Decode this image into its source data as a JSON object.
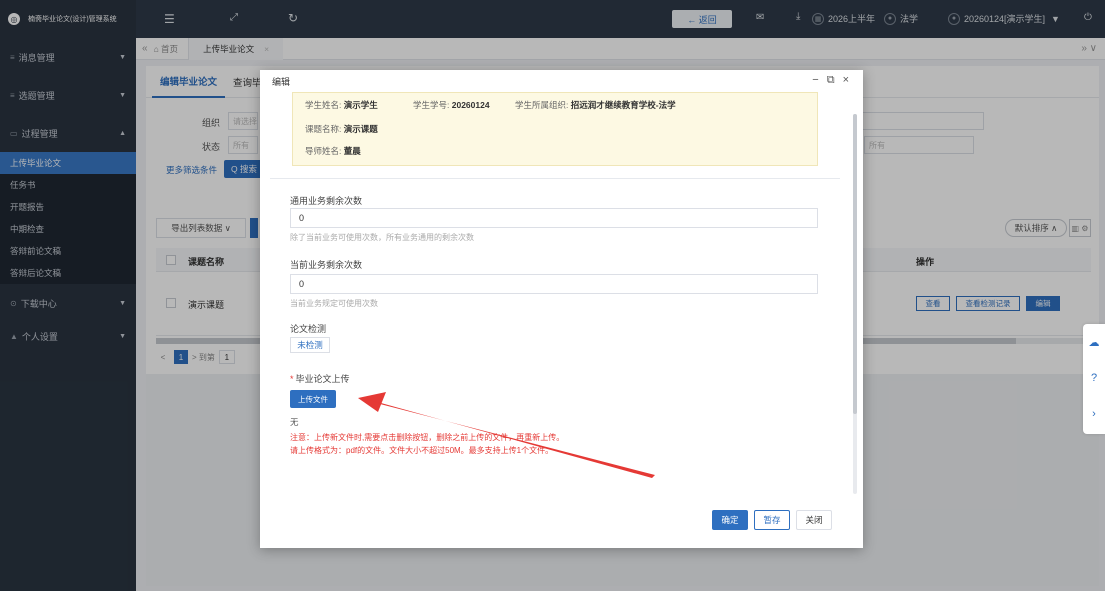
{
  "sidebar": {
    "brand": "楠斋毕业论文(设计)管理系统",
    "groups": [
      {
        "label": "消息管理",
        "icon": "≡"
      },
      {
        "label": "选题管理",
        "icon": "≡"
      },
      {
        "label": "过程管理",
        "icon": "▭"
      }
    ],
    "sub_items": [
      "上传毕业论文",
      "任务书",
      "开题报告",
      "中期检查",
      "答辩前论文稿",
      "答辩后论文稿"
    ],
    "bottom_groups": [
      {
        "label": "下载中心",
        "icon": "⊙"
      },
      {
        "label": "个人设置",
        "icon": "▲"
      }
    ]
  },
  "topbar": {
    "back_label": "← 返回",
    "term": "2026上半年",
    "major": "法学",
    "user": "20260124[演示学生]"
  },
  "tabstrip": {
    "home": "⌂ 首页",
    "tab": "上传毕业论文"
  },
  "content": {
    "subtabs": [
      "编辑毕业论文",
      "查询毕业"
    ],
    "filter_org_label": "组织",
    "filter_org_placeholder": "请选择",
    "filter_status_label": "状态",
    "filter_status_placeholder": "所有",
    "right_filter_placeholder": "所有",
    "more_filter": "更多筛选条件",
    "search": "Q 搜索",
    "export": "导出列表数据  ∨",
    "sort": "默认排序 ∧",
    "col_title": "课题名称",
    "col_ops": "操作",
    "row_title": "演示课题",
    "op_view": "查看",
    "op_check_records": "查看检测记录",
    "op_edit": "编辑",
    "pager_prev": "<",
    "pager_cur": "1",
    "pager_next": "> 到第",
    "pager_input": "1"
  },
  "modal": {
    "title": "编辑",
    "student_name_label": "学生姓名:",
    "student_name": "演示学生",
    "student_no_label": "学生学号:",
    "student_no": "20260124",
    "org_label": "学生所属组织:",
    "org": "招远润才继续教育学校-法学",
    "topic_label": "课题名称:",
    "topic": "演示课题",
    "tutor_label": "导师姓名:",
    "tutor": "董晨",
    "general_remaining_label": "通用业务剩余次数",
    "general_remaining_value": "0",
    "general_remaining_hint": "除了当前业务可使用次数，所有业务通用的剩余次数",
    "current_remaining_label": "当前业务剩余次数",
    "current_remaining_value": "0",
    "current_remaining_hint": "当前业务规定可使用次数",
    "check_label": "论文检测",
    "check_status": "未检测",
    "upload_label": "毕业论文上传",
    "upload_required": "*",
    "upload_btn": "上传文件",
    "none": "无",
    "note1": "注意：上传新文件时,需要点击删除按钮，删除之前上传的文件，再重新上传。",
    "note2": "请上传格式为：pdf的文件。文件大小不超过50M。最多支持上传1个文件。",
    "confirm": "确定",
    "save_draft": "暂存",
    "close": "关闭"
  },
  "colors": {
    "primary": "#2e6fc0",
    "sidebar": "#2a3441",
    "warning_text": "#e53935",
    "info_bg": "#fdf9e3",
    "annotation_arrow": "#e53935"
  }
}
